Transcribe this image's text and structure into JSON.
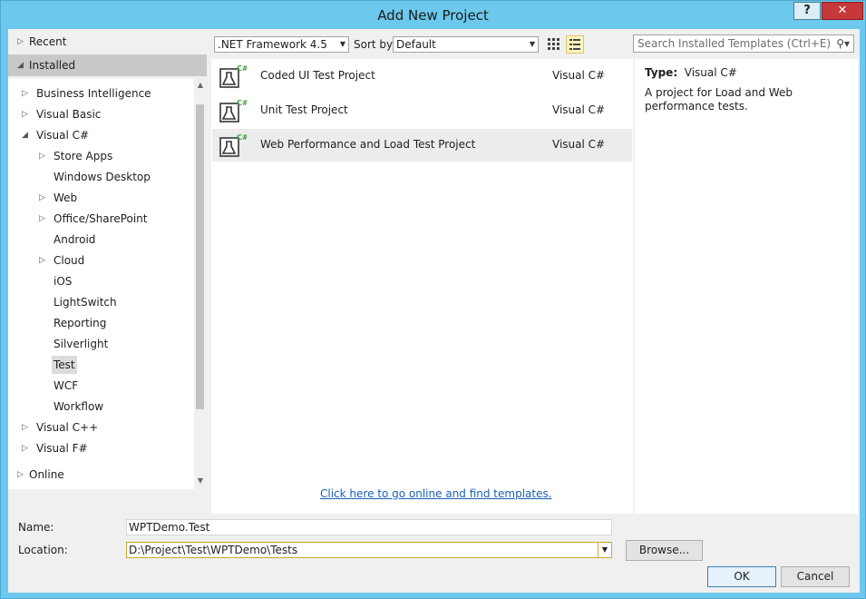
{
  "window": {
    "title": "Add New Project",
    "help_label": "?",
    "close_label": "✕"
  },
  "left": {
    "recent": "Recent",
    "installed": "Installed",
    "online": "Online",
    "tree": [
      {
        "label": "Business Intelligence",
        "arrow": "▷"
      },
      {
        "label": "Visual Basic",
        "arrow": "▷"
      },
      {
        "label": "Visual C#",
        "arrow": "◢"
      },
      {
        "label": "Store Apps",
        "arrow": "▷"
      },
      {
        "label": "Windows Desktop",
        "arrow": ""
      },
      {
        "label": "Web",
        "arrow": "▷"
      },
      {
        "label": "Office/SharePoint",
        "arrow": "▷"
      },
      {
        "label": "Android",
        "arrow": ""
      },
      {
        "label": "Cloud",
        "arrow": "▷"
      },
      {
        "label": "iOS",
        "arrow": ""
      },
      {
        "label": "LightSwitch",
        "arrow": ""
      },
      {
        "label": "Reporting",
        "arrow": ""
      },
      {
        "label": "Silverlight",
        "arrow": ""
      },
      {
        "label": "Test",
        "arrow": ""
      },
      {
        "label": "WCF",
        "arrow": ""
      },
      {
        "label": "Workflow",
        "arrow": ""
      },
      {
        "label": "Visual C++",
        "arrow": "▷"
      },
      {
        "label": "Visual F#",
        "arrow": "▷"
      }
    ]
  },
  "toolbar": {
    "framework": ".NET Framework 4.5",
    "sort_label": "Sort by:",
    "sort_value": "Default",
    "search_placeholder": "Search Installed Templates (Ctrl+E)"
  },
  "templates": [
    {
      "name": "Coded UI Test Project",
      "lang": "Visual C#",
      "icon": "test-flask-icon"
    },
    {
      "name": "Unit Test Project",
      "lang": "Visual C#",
      "icon": "test-flask-icon"
    },
    {
      "name": "Web Performance and Load Test Project",
      "lang": "Visual C#",
      "icon": "test-flask-icon"
    }
  ],
  "online_link": "Click here to go online and find templates.",
  "details": {
    "type_label": "Type:",
    "type_value": "Visual C#",
    "description": "A project for Load and Web performance tests."
  },
  "form": {
    "name_label": "Name:",
    "name_value": "WPTDemo.Test",
    "location_label": "Location:",
    "location_value": "D:\\Project\\Test\\WPTDemo\\Tests",
    "browse_label": "Browse...",
    "ok_label": "OK",
    "cancel_label": "Cancel"
  },
  "colors": {
    "title_bar": "#6cc8ec",
    "close_button": "#c7383a",
    "link": "#1a5fb4"
  }
}
